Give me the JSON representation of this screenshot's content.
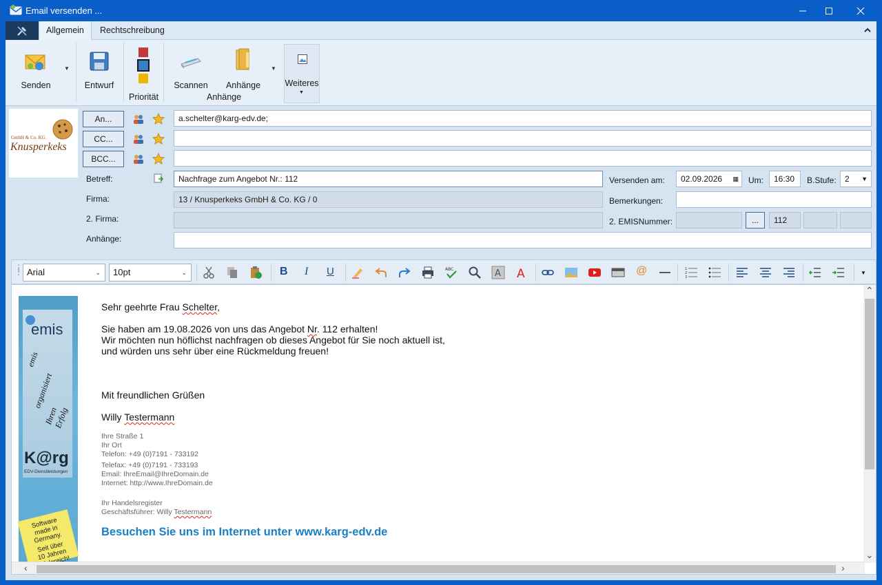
{
  "window": {
    "title": "Email versenden ..."
  },
  "tabs": [
    {
      "label": "Allgemein"
    },
    {
      "label": "Rechtschreibung"
    }
  ],
  "ribbon": {
    "send_label": "Senden",
    "draft_label": "Entwurf",
    "priority_group": "Priorität",
    "scan_label": "Scannen",
    "attachments_label": "Anhänge",
    "attachments_group": "Anhänge",
    "more_label": "Weiteres",
    "priority_colors": [
      "#c0393b",
      "#3a7fc6",
      "#f0b400"
    ]
  },
  "logo": {
    "small": "GmbH & Co. KG",
    "name": "Knusperkeks"
  },
  "form": {
    "to_btn": "An...",
    "cc_btn": "CC...",
    "bcc_btn": "BCC...",
    "to_value": "a.schelter@karg-edv.de;",
    "cc_value": "",
    "bcc_value": "",
    "subject_label": "Betreff:",
    "subject_value": "Nachfrage zum Angebot Nr.: 112",
    "company_label": "Firma:",
    "company_value": "13 / Knusperkeks GmbH & Co. KG / 0",
    "company2_label": "2. Firma:",
    "company2_value": "",
    "attachments_label": "Anhänge:",
    "attachments_value": "",
    "send_on_label": "Versenden am:",
    "send_on_value": "02.09.2026",
    "at_label": "Um:",
    "at_value": "16:30",
    "level_label": "B.Stufe:",
    "level_value": "2",
    "remarks_label": "Bemerkungen:",
    "remarks_value": "",
    "emis_label": "2. EMISNummer:",
    "emis_btn": "...",
    "emis_value": "112"
  },
  "editor_toolbar": {
    "font": "Arial",
    "size": "10pt"
  },
  "banner": {
    "brand": "emis",
    "slogan_1": "emis",
    "slogan_2": "organisiert",
    "slogan_3": "Ihren Erfolg",
    "karg": "K@rg",
    "karg_sub": "EDV-Dienstleistungen",
    "postit_1": "Software",
    "postit_2": "made in",
    "postit_3": "Germany.",
    "postit_4": "Seit über",
    "postit_5": "10 Jahren",
    "postit_6": "erfolgreich!"
  },
  "mail": {
    "greeting_pre": "Sehr geehrte Frau ",
    "greeting_name": "Schelter",
    "greeting_post": ",",
    "line1_pre": "Sie haben am 19.08.2026 von uns das Angebot ",
    "line1_nr": "Nr",
    "line1_post": ". 112 erhalten!",
    "line2": "Wir möchten nun höflichst nachfragen ob dieses Angebot für Sie noch aktuell ist,",
    "line3": "und würden uns sehr über eine Rückmeldung freuen!",
    "closing": "Mit freundlichen Grüßen",
    "signer_first": "Willy ",
    "signer_last": "Testermann",
    "street": "Ihre Straße 1",
    "city": "Ihr Ort",
    "phone": "Telefon: +49 (0)7191 - 733192",
    "fax": "Telefax: +49 (0)7191 - 733193",
    "email": "Email:  IhreEmail@IhreDomain.de",
    "web": "Internet: http://www.IhreDomain.de",
    "register": "Ihr Handelsregister",
    "manager_pre": "Geschäftsführer: Willy ",
    "manager_last": "Testermann",
    "visit": "Besuchen Sie uns im Internet unter www.karg-edv.de"
  }
}
